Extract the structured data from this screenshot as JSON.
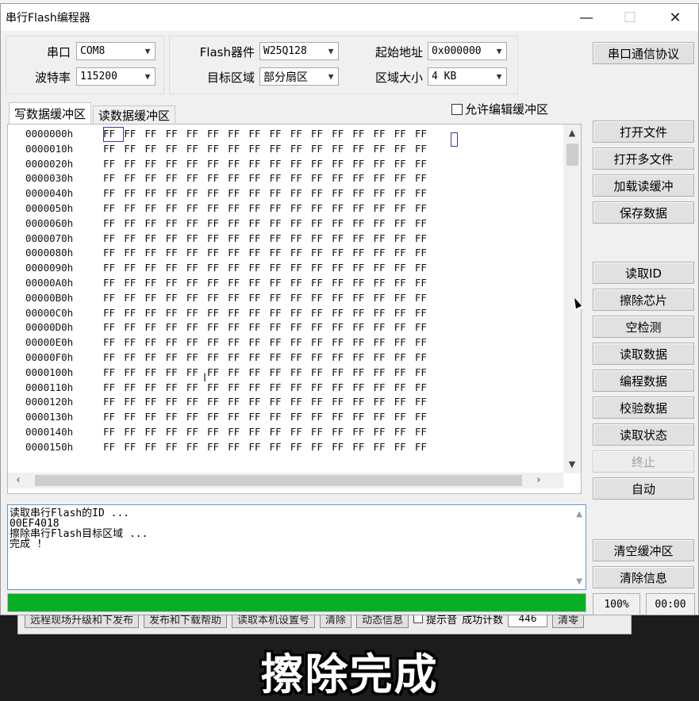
{
  "window": {
    "title": "串行Flash编程器"
  },
  "config": {
    "port_label": "串口",
    "port_value": "COM8",
    "baud_label": "波特率",
    "baud_value": "115200",
    "device_label": "Flash器件",
    "device_value": "W25Q128",
    "target_label": "目标区域",
    "target_value": "部分扇区",
    "start_label": "起始地址",
    "start_value": "0x000000",
    "size_label": "区域大小",
    "size_value": "4 KB",
    "protocol_button": "串口通信协议"
  },
  "tabs": {
    "write": "写数据缓冲区",
    "read": "读数据缓冲区",
    "allow_edit": "允许编辑缓冲区"
  },
  "buttons": {
    "open_file": "打开文件",
    "open_multi": "打开多文件",
    "load_read": "加载读缓冲",
    "save_data": "保存数据",
    "read_id": "读取ID",
    "erase_chip": "擦除芯片",
    "blank_check": "空检测",
    "read_data": "读取数据",
    "program_data": "编程数据",
    "verify_data": "校验数据",
    "read_status": "读取状态",
    "stop": "终止",
    "auto": "自动",
    "clear_buffer": "清空缓冲区",
    "clear_info": "清除信息"
  },
  "hex": {
    "addresses": [
      "0000000h",
      "0000010h",
      "0000020h",
      "0000030h",
      "0000040h",
      "0000050h",
      "0000060h",
      "0000070h",
      "0000080h",
      "0000090h",
      "00000A0h",
      "00000B0h",
      "00000C0h",
      "00000D0h",
      "00000E0h",
      "00000F0h",
      "0000100h",
      "0000110h",
      "0000120h",
      "0000130h",
      "0000140h",
      "0000150h"
    ],
    "byte": "FF"
  },
  "log": {
    "lines": [
      "读取串行Flash的ID ...",
      "00EF4018",
      "擦除串行Flash目标区域 ...",
      "完成 !"
    ]
  },
  "status": {
    "progress_percent": 100,
    "progress_text": "100%",
    "time": "00:00"
  },
  "background_app": {
    "buttons": [
      "远程现场升级和下发布",
      "发布和下载帮助",
      "读取本机设置号",
      "清除",
      "动态信息"
    ],
    "checkbox": "提示音",
    "count_label": "成功计数",
    "count_value": "446",
    "reset_button": "清零"
  },
  "subtitle": "擦除完成",
  "colors": {
    "progress_green": "#06b025",
    "log_border": "#5a9bd5"
  }
}
